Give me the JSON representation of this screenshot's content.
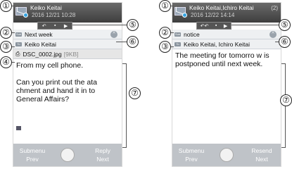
{
  "callouts": [
    "①",
    "②",
    "③",
    "④",
    "⑤",
    "⑥",
    "⑦"
  ],
  "left": {
    "from": "Keiko Keitai",
    "date": "2016 12/21 10:28",
    "icons": [
      "↶",
      "▪",
      "▶"
    ],
    "subject": "Next week",
    "to": "Keiko Keitai",
    "attachment": "DSC_0002.jpg",
    "attachment_size": "[9KB]",
    "body": [
      "From my cell phone.",
      "",
      "Can you print out the ata chment and hand it in to General Affairs?"
    ],
    "footer": {
      "left1": "Submenu",
      "left2": "Prev",
      "right1": "Reply",
      "right2": "Next"
    }
  },
  "right": {
    "from": "Keiko Keitai,Ichiro Keitai",
    "count": "(2)",
    "date": "2016 12/22 14:14",
    "icons": [
      "↶↶",
      "▪",
      "▶"
    ],
    "subject": "notice",
    "to": "Keiko Keitai, Ichiro Keitai",
    "body": [
      "The meeting for tomorro w is postponed until next week."
    ],
    "footer": {
      "left1": "Submenu",
      "left2": "Prev",
      "right1": "Resend",
      "right2": "Next"
    }
  }
}
